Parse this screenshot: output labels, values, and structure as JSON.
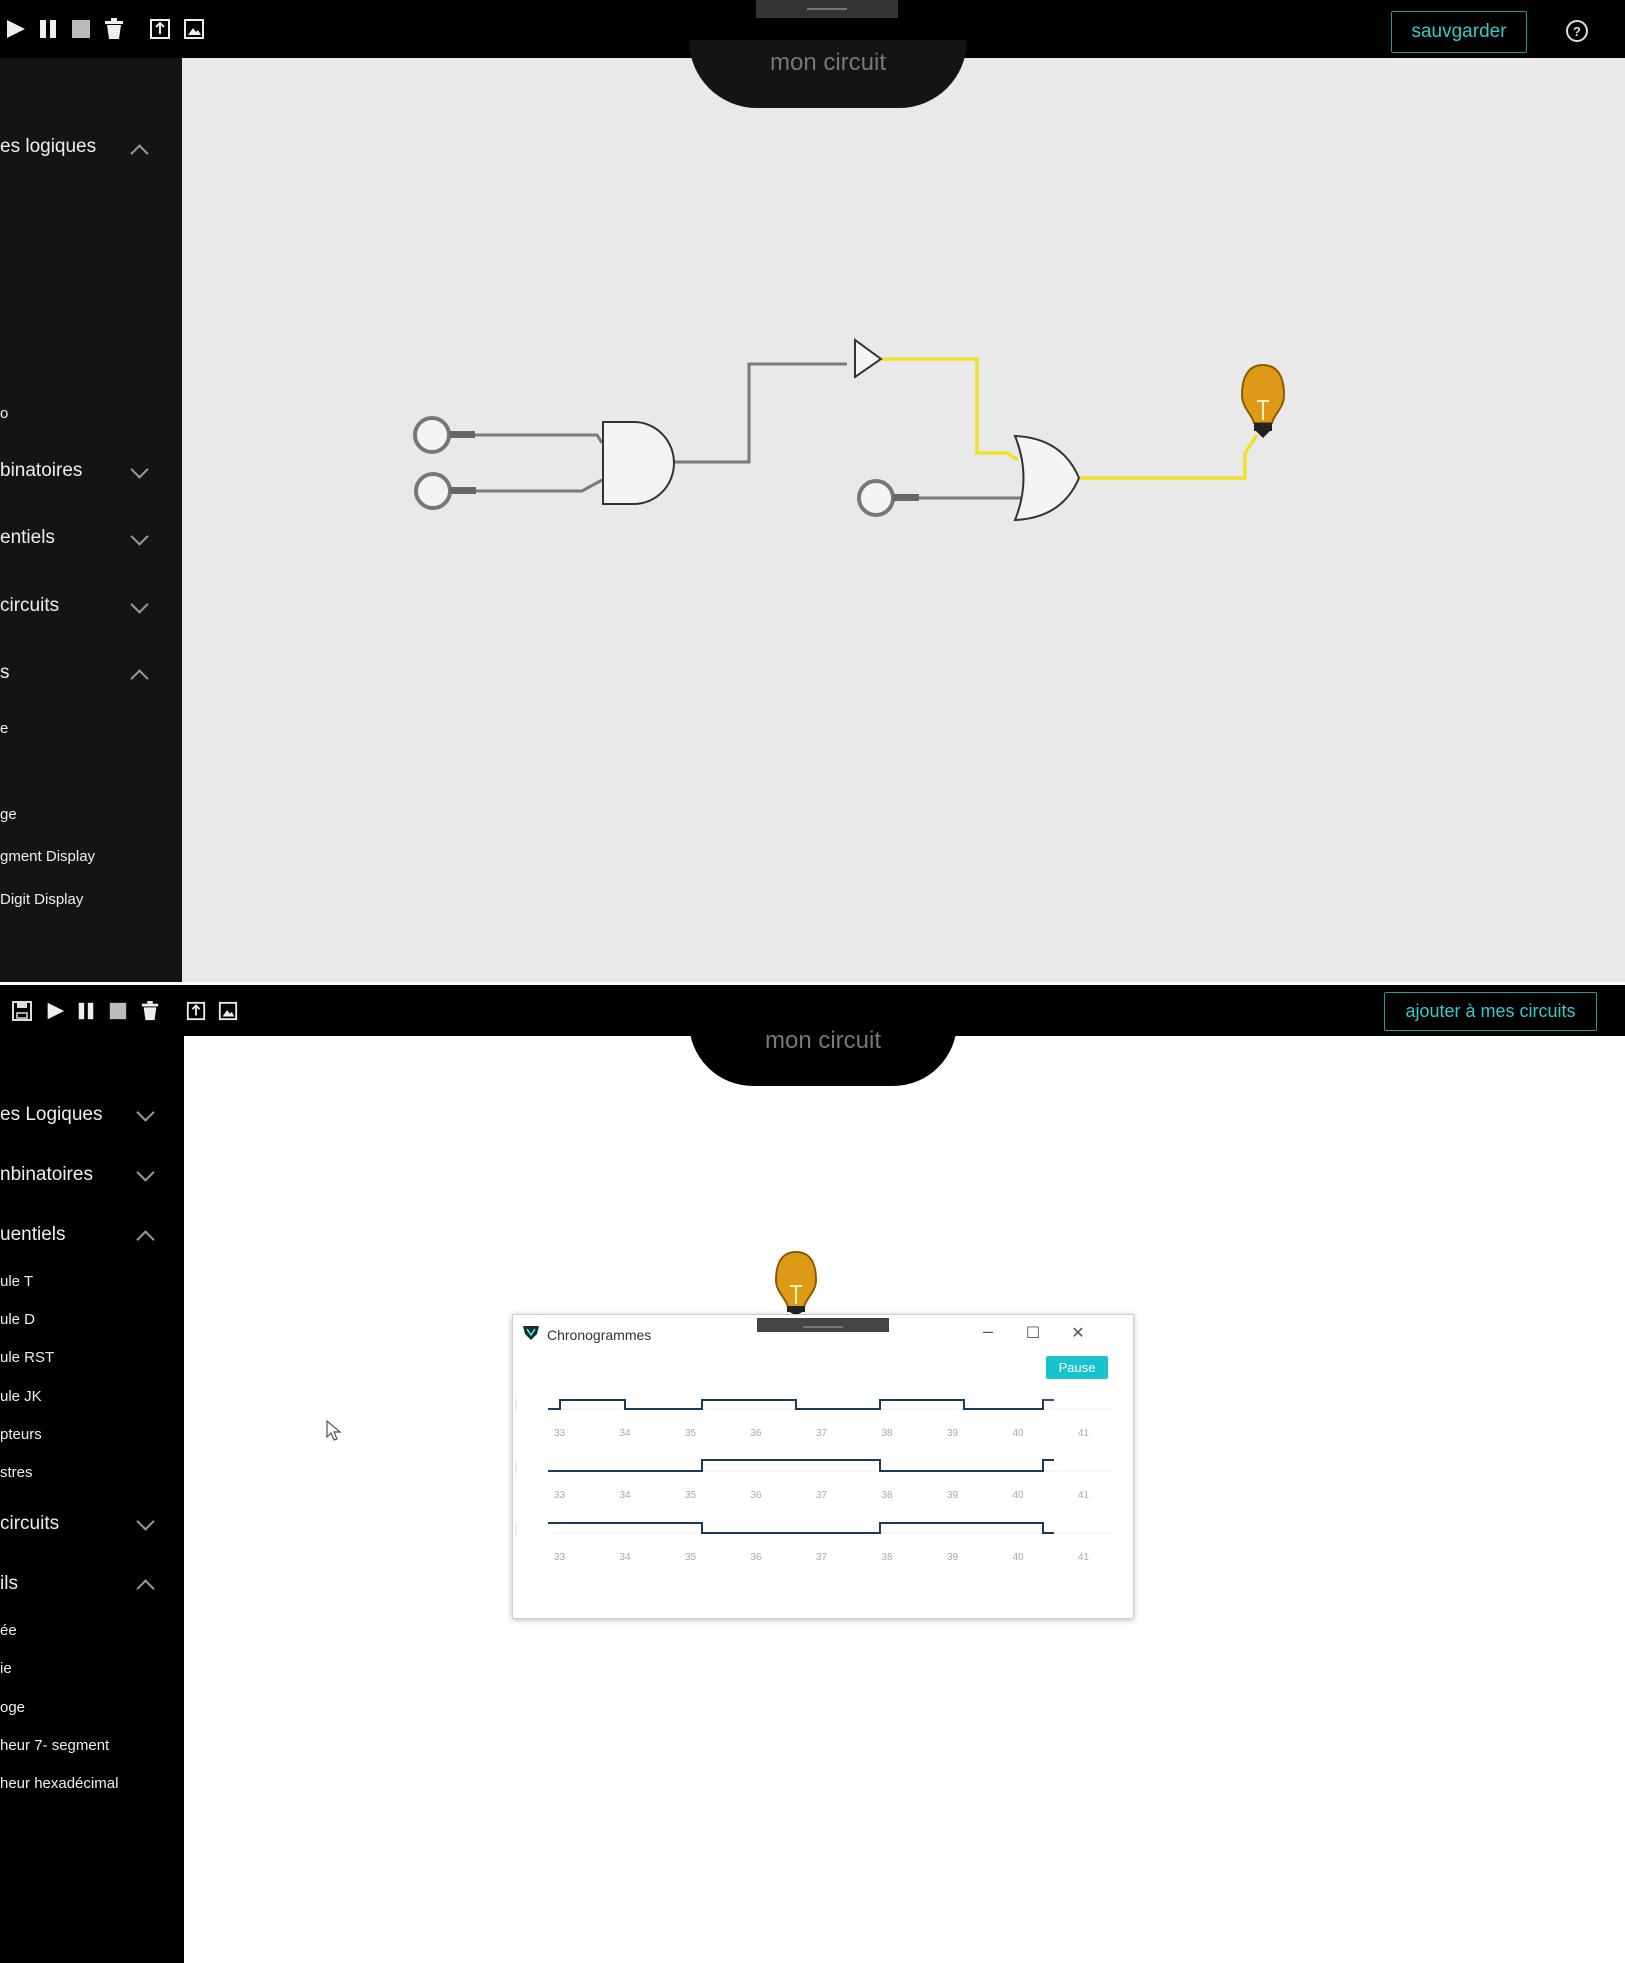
{
  "screen1": {
    "toolbar": {
      "icons": [
        "play-icon",
        "pause-icon",
        "stop-icon",
        "trash-icon",
        "export-icon",
        "image-icon"
      ],
      "save_label": "sauvgarder",
      "help_label": "?"
    },
    "title": "mon circuit",
    "sidebar": {
      "categories": [
        {
          "label": "es logiques",
          "chevron": "up"
        },
        {
          "label": "binatoires",
          "chevron": "down"
        },
        {
          "label": "entiels",
          "chevron": "down"
        },
        {
          "label": "circuits",
          "chevron": "down"
        },
        {
          "label": "s",
          "chevron": "up"
        }
      ],
      "partial": "o",
      "items": [
        "e",
        "ge",
        "gment Display",
        "Digit Display"
      ]
    },
    "circuit": {
      "components": [
        "input-switch",
        "input-switch",
        "and-gate",
        "buffer-gate",
        "input-switch",
        "or-gate",
        "light-bulb"
      ],
      "bulb_color": "#dd9a16",
      "active_wire_color": "#f0e12a",
      "wire_color": "#7a7a7a"
    }
  },
  "screen2": {
    "toolbar": {
      "icons": [
        "save-icon",
        "play-icon",
        "pause-icon",
        "stop-icon",
        "trash-icon",
        "export-icon",
        "image-icon"
      ],
      "add_label": "ajouter à mes circuits"
    },
    "title": "mon circuit",
    "sidebar": {
      "categories": [
        {
          "label": "es Logiques",
          "chevron": "down"
        },
        {
          "label": "nbinatoires",
          "chevron": "down"
        },
        {
          "label": "uentiels",
          "chevron": "up"
        }
      ],
      "items1": [
        "ule T",
        "ule D",
        "ule RST",
        "ule JK",
        "pteurs",
        "stres"
      ],
      "categories2": [
        {
          "label": "circuits",
          "chevron": "down"
        },
        {
          "label": "ils",
          "chevron": "up"
        }
      ],
      "items2": [
        "ée",
        "ie",
        "oge",
        "heur 7- segment",
        "heur hexadécimal"
      ]
    },
    "chronogramme": {
      "title": "Chronogrammes",
      "pause_label": "Pause",
      "minimize": "–",
      "maximize": "☐",
      "close": "✕",
      "ticks": [
        "33",
        "34",
        "35",
        "36",
        "37",
        "38",
        "39",
        "40",
        "41"
      ]
    }
  }
}
